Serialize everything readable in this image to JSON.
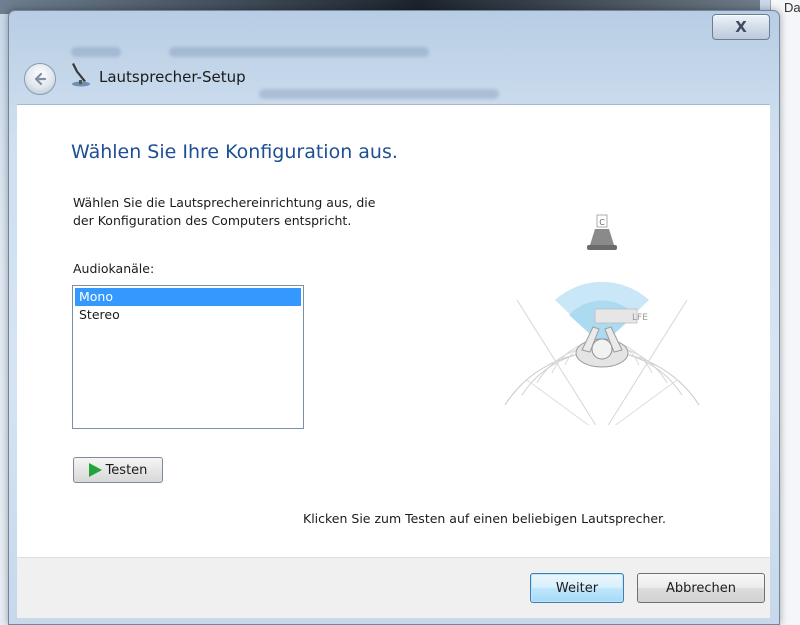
{
  "background": {
    "right_edge_text": "Dat"
  },
  "window": {
    "title": "Lautsprecher-Setup",
    "close_label": "X"
  },
  "content": {
    "heading": "Wählen Sie Ihre Konfiguration aus.",
    "description_line1": "Wählen Sie die Lautsprechereinrichtung aus, die",
    "description_line2": "der Konfiguration des Computers entspricht.",
    "channels_label": "Audiokanäle:",
    "channels": [
      "Mono",
      "Stereo"
    ],
    "selected_channel": "Mono",
    "test_button": "Testen",
    "hint": "Klicken Sie zum Testen auf einen beliebigen Lautsprecher.",
    "diagram": {
      "speaker_label": "C",
      "subwoofer_label": "LFE"
    }
  },
  "footer": {
    "next_button": "Weiter",
    "cancel_button": "Abbrechen"
  },
  "colors": {
    "heading": "#1e4f94",
    "selection": "#3399ff",
    "play_icon": "#25a33b"
  },
  "icons": {
    "back": "back-arrow-icon",
    "title": "microphone-speaker-icon",
    "test": "play-icon",
    "close": "close-icon"
  }
}
